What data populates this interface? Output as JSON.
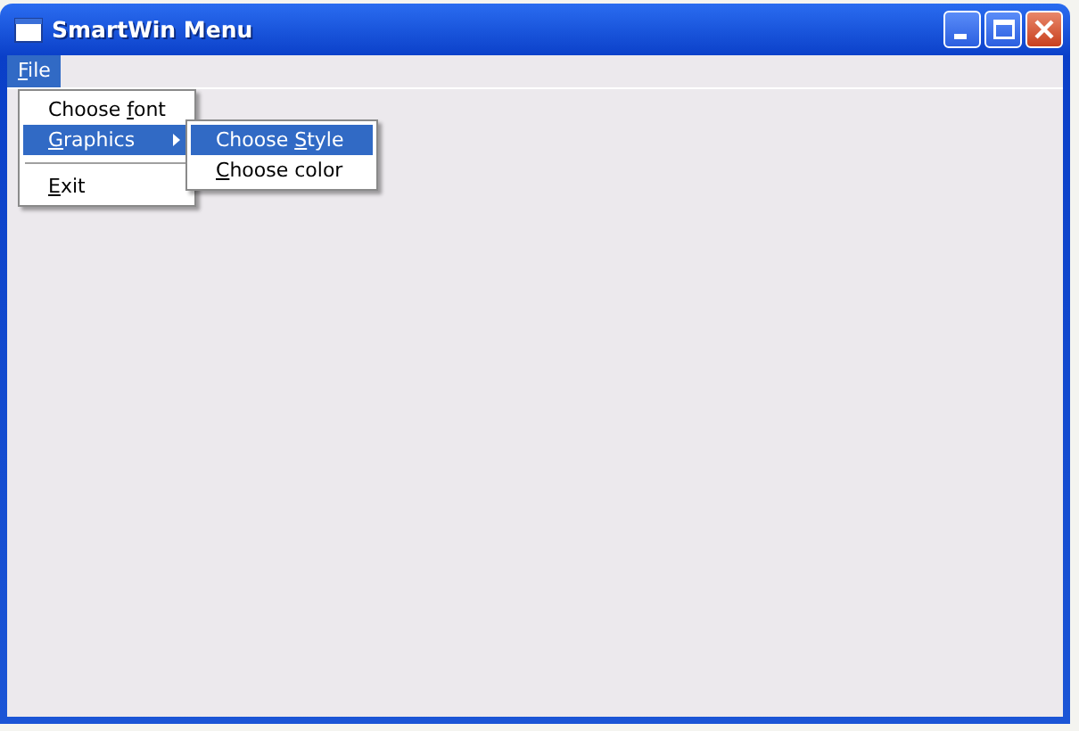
{
  "window": {
    "title": "SmartWin Menu"
  },
  "menubar": [
    {
      "key": "F",
      "after": "ile",
      "selected": true
    }
  ],
  "menu": [
    {
      "kind": "item",
      "before": "Choose ",
      "key": "f",
      "after": "ont",
      "selected": false
    },
    {
      "kind": "submenu",
      "key": "G",
      "after": "raphics",
      "selected": true
    },
    {
      "kind": "separator"
    },
    {
      "kind": "item",
      "key": "E",
      "after": "xit",
      "selected": false
    }
  ],
  "submenu": [
    {
      "kind": "item",
      "before": "Choose ",
      "key": "S",
      "after": "tyle",
      "selected": true
    },
    {
      "kind": "item",
      "key": "C",
      "after": "hoose color",
      "selected": false
    }
  ]
}
